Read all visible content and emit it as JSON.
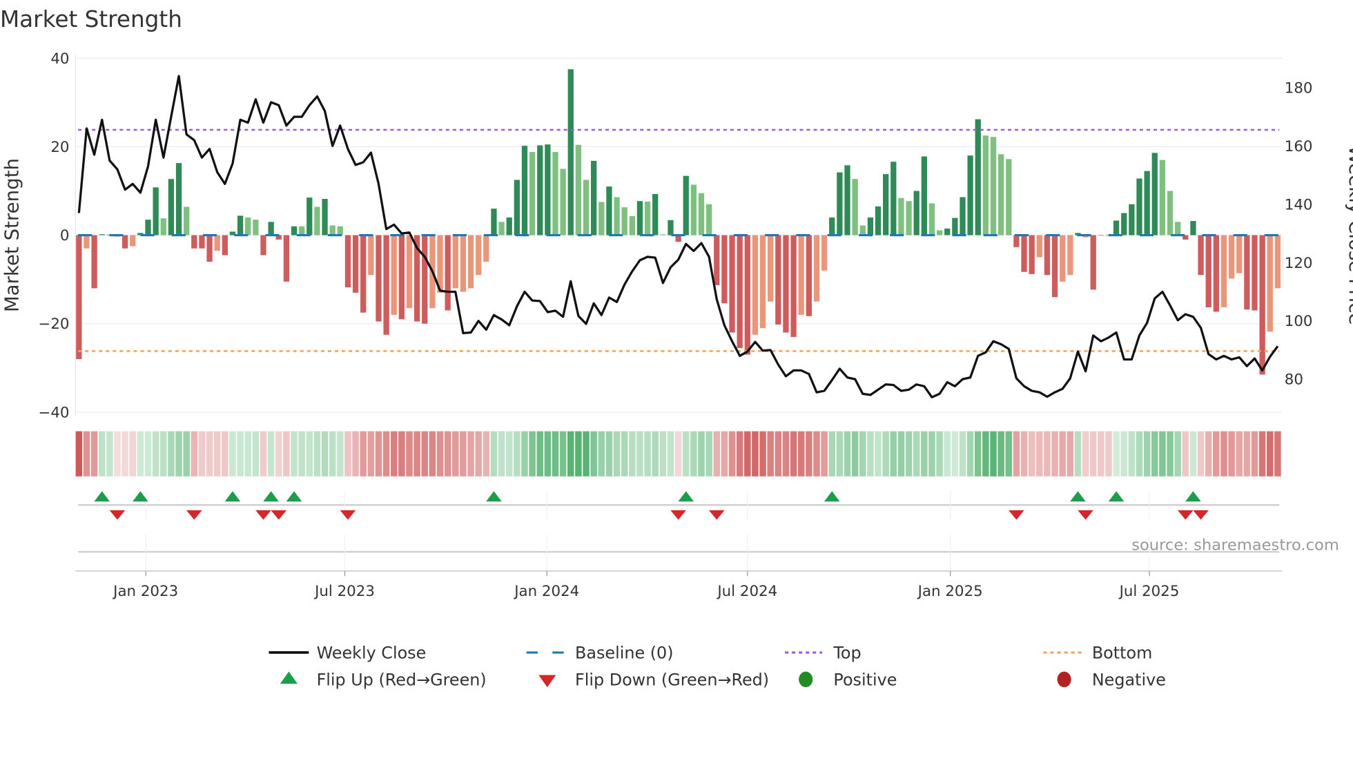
{
  "title": "Market Strength",
  "source": "source: sharemaestro.com",
  "chart_data": {
    "type": "bar",
    "title": "Market Strength",
    "ylabel": "Market Strength",
    "y2label": "Weekly Close Price",
    "ylim": [
      -40,
      40
    ],
    "y2lim": [
      68.1,
      190.1
    ],
    "yticks": [
      "40",
      "20",
      "0",
      "−20",
      "−40"
    ],
    "ytick_values": [
      40,
      20,
      0,
      -20,
      -40
    ],
    "y2ticks": [
      "80",
      "100",
      "120",
      "140",
      "160",
      "180"
    ],
    "y2tick_values": [
      80,
      100,
      120,
      140,
      160,
      180
    ],
    "x_unit": "week index",
    "weeks": 157,
    "xticks": [
      {
        "label": "Jan 2023",
        "at_week": 8.7
      },
      {
        "label": "Jul 2023",
        "at_week": 34.6
      },
      {
        "label": "Jan 2024",
        "at_week": 60.9
      },
      {
        "label": "Jul 2024",
        "at_week": 87.0
      },
      {
        "label": "Jan 2025",
        "at_week": 113.4
      },
      {
        "label": "Jul 2025",
        "at_week": 139.3
      }
    ],
    "top_level": 23.8,
    "bottom_level": -26.2,
    "baseline": 0,
    "strength": [
      -28,
      -3,
      -12,
      0.2,
      0.1,
      -0.3,
      -3,
      -2.5,
      0.5,
      3.5,
      10.8,
      3.8,
      12.7,
      16.3,
      6.4,
      -3,
      -3,
      -6,
      -3.5,
      -4.5,
      0.8,
      4.4,
      4,
      3.5,
      -4.5,
      3,
      -1,
      -10.5,
      2,
      2,
      8.5,
      6.4,
      8.2,
      2.2,
      2,
      -11.8,
      -13,
      -17.5,
      -9,
      -19.5,
      -22.5,
      -18,
      -19,
      -16.5,
      -19.5,
      -20,
      -16.5,
      -13,
      -17,
      -12,
      -12.8,
      -12,
      -9,
      -6,
      6,
      3,
      4,
      12.5,
      20.2,
      18.8,
      20.3,
      20.5,
      18.8,
      15,
      37.5,
      20.4,
      12.5,
      16.8,
      7.5,
      11,
      8.6,
      6.3,
      4.3,
      7.7,
      7.6,
      9.3,
      0.2,
      3.4,
      -1.5,
      13.4,
      11.4,
      9.5,
      7,
      -11.3,
      -15.4,
      -22,
      -25.5,
      -27,
      -22.5,
      -21,
      -15,
      -20.2,
      -22,
      -23,
      -18,
      -18.3,
      -15,
      -8,
      4,
      14.2,
      15.8,
      12.7,
      2.2,
      4,
      6.5,
      13.8,
      16.6,
      8.4,
      7.7,
      10,
      17.8,
      7.2,
      1.1,
      1.5,
      3.9,
      8.6,
      18,
      26.2,
      22.5,
      22.2,
      18.3,
      17.2,
      -2.7,
      -8.3,
      -8.8,
      -5,
      -9,
      -14,
      -10.5,
      -9,
      0.5,
      -0.5,
      -12.3,
      -0.1,
      -0.1,
      3.3,
      5,
      7,
      12.8,
      14.5,
      18.6,
      17,
      10,
      3,
      -1,
      3.2,
      -9,
      -16.3,
      -17.3,
      -16.3,
      -9.8,
      -8.6,
      -16.8,
      -17,
      -31.5,
      -21.8,
      -12
    ],
    "strength_shade": "DLDDDDDLDDDLDDLDDDLDDDLLDDDDDLDLDLLDDDLDDLDLDDLLDLLLLLDLDDDLDDLLDLLDLDLLLDLDLDDDLLLDDDDDLLLDDDLDLLDDDLLDDDDLLDDLLDDDDDLLLLDDDLDDLLDLDDDDDDDDDLLLDDDDDLLLDDDLL",
    "weekly_close": [
      137,
      166,
      157,
      169,
      155,
      152,
      145,
      147,
      144,
      153,
      169,
      156,
      170,
      184,
      164,
      162,
      156,
      159,
      151,
      147,
      154,
      169,
      168,
      176,
      168,
      175,
      174,
      167,
      170,
      170,
      174,
      177,
      172,
      160,
      167,
      159,
      153.5,
      154.4,
      157.7,
      147,
      131.5,
      133,
      130,
      130.3,
      125,
      122,
      117,
      110.4,
      110,
      110,
      95.8,
      96,
      100,
      97,
      102,
      100.5,
      98.5,
      105,
      110,
      107,
      106.8,
      103,
      103.5,
      101.4,
      113.6,
      101.7,
      99,
      106,
      102,
      108,
      106.5,
      112.5,
      117,
      120.8,
      122,
      121.7,
      113,
      118.4,
      121,
      126.4,
      124,
      126.7,
      122,
      107.4,
      98.5,
      93,
      88,
      89.5,
      92.8,
      89.8,
      90,
      85,
      81,
      83,
      83,
      81.8,
      75.5,
      76,
      79.7,
      83.6,
      80.6,
      80,
      75,
      74.6,
      76.4,
      78.2,
      78,
      76,
      76.4,
      78.2,
      77.6,
      73.8,
      75,
      79,
      77.6,
      80,
      80.6,
      88,
      89.2,
      93,
      92,
      90.4,
      80.3,
      77.6,
      76,
      75.5,
      74,
      75.5,
      76.7,
      80.3,
      89.5,
      82.7,
      95,
      93,
      94.3,
      96,
      86.8,
      86.8,
      95,
      99.3,
      107.7,
      110,
      105.3,
      100.2,
      102.3,
      101.4,
      97.6,
      88.6,
      86.8,
      88,
      86.8,
      87.5,
      84.5,
      87.1,
      83,
      87.7,
      91.3
    ],
    "flip_up_weeks": [
      3,
      8,
      20,
      25,
      28,
      54,
      79,
      98,
      130,
      135,
      145
    ],
    "flip_down_weeks": [
      5,
      15,
      24,
      26,
      35,
      78,
      83,
      122,
      131,
      144,
      146
    ],
    "legend_position": "bottom",
    "legend": [
      {
        "label": "Weekly Close",
        "kind": "line"
      },
      {
        "label": "Baseline (0)",
        "kind": "dashed"
      },
      {
        "label": "Top",
        "kind": "dotted"
      },
      {
        "label": "Bottom",
        "kind": "dotted"
      },
      {
        "label": "Flip Up (Red→Green)",
        "kind": "triangle-up"
      },
      {
        "label": "Flip Down (Green→Red)",
        "kind": "triangle-down"
      },
      {
        "label": "Positive",
        "kind": "circle"
      },
      {
        "label": "Negative",
        "kind": "circle"
      }
    ],
    "colors": {
      "pos_dark": "#2e8b57",
      "pos_light": "#7fbf7f",
      "neg_dark": "#cd5c5c",
      "neg_light": "#e9967a",
      "close": "#111111",
      "baseline": "#1f77b4",
      "top": "#9b59e0",
      "bottom": "#f4a261",
      "flip_up": "#1a9e4a",
      "flip_down": "#d62728",
      "positive": "#228b22",
      "negative": "#b22222"
    }
  }
}
